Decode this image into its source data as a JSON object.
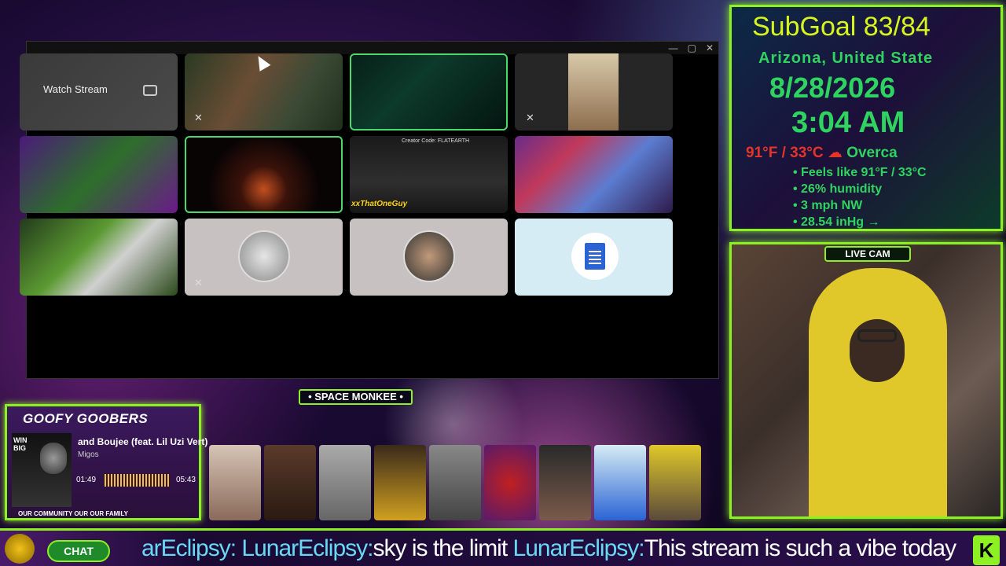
{
  "main_window": {
    "controls": {
      "minimize": "—",
      "maximize": "▢",
      "close": "✕"
    },
    "tiles": [
      {
        "kind": "watch",
        "watch_label": "Watch Stream"
      },
      {
        "kind": "video",
        "speaking": false
      },
      {
        "kind": "video",
        "speaking": true
      },
      {
        "kind": "video",
        "muted": true
      },
      {
        "kind": "video"
      },
      {
        "kind": "video",
        "speaking": true
      },
      {
        "kind": "video",
        "creator_code": "Creator Code: FLATEARTH",
        "gamer_tag": "xxThatOneGuy"
      },
      {
        "kind": "video"
      },
      {
        "kind": "video"
      },
      {
        "kind": "avatar",
        "muted": true
      },
      {
        "kind": "avatar"
      },
      {
        "kind": "doc"
      }
    ]
  },
  "info_panel": {
    "subgoal": "SubGoal 83/84",
    "location": "Arizona, United State",
    "date": "8/28/2026",
    "time": "3:04 AM",
    "temp": "91°F / 33°C",
    "condition": "Overca",
    "feels_like": "• Feels like 91°F / 33°C",
    "humidity": "• 26% humidity",
    "wind": "• 3 mph NW",
    "pressure": "• 28.54 inHg →"
  },
  "livecam": {
    "label": "LIVE CAM"
  },
  "space_bar": {
    "label": "• SPACE MONKEE •"
  },
  "music": {
    "title": "GOOFY GOOBERS",
    "album_text": "WIN\nBIG",
    "song": "and Boujee (feat. Lil Uzi Vert)",
    "artist": "Migos",
    "elapsed": "01:49",
    "duration": "05:43",
    "community": "OUR COMMUNITY   OUR         OUR FAMILY"
  },
  "chat": {
    "button_label": "CHAT",
    "ticker_prefix": "arEclipsy:",
    "ticker_user1": "LunarEclipsy:",
    "ticker_msg1": "sky is the limit ",
    "ticker_user2": "LunarEclipsy:",
    "ticker_msg2": "This stream is such a vibe today",
    "k_logo": "K"
  },
  "colors": {
    "neon_green": "#8cf023",
    "text_green": "#2fd460",
    "subgoal_yellow": "#d7f51c",
    "temp_red": "#e5342a"
  }
}
